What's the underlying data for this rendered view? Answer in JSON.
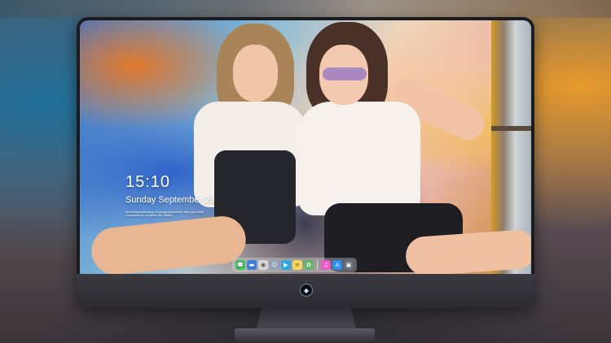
{
  "lockscreen": {
    "time": "15:10",
    "date": "Sunday September 28",
    "tagline": "Innovating technology, Ensuring productivity, Max, your ideal companion for a smarter life, Seewo"
  },
  "dock": {
    "icons": [
      {
        "name": "messages-icon",
        "glyph": "💬",
        "color": "#3cc45a"
      },
      {
        "name": "files-icon",
        "glyph": "▬",
        "color": "#3b7ddd"
      },
      {
        "name": "browser-icon",
        "glyph": "◉",
        "color": "#d8d8d8"
      },
      {
        "name": "finder-icon",
        "glyph": "☺",
        "color": "#8fa2b8"
      },
      {
        "name": "video-icon",
        "glyph": "▶",
        "color": "#29a9e0"
      },
      {
        "name": "notes-icon",
        "glyph": "≡",
        "color": "#f6d860"
      },
      {
        "name": "photos-icon",
        "glyph": "✿",
        "color": "#66b36b"
      },
      {
        "name": "music-icon",
        "glyph": "♫",
        "color": "#e95cc4"
      },
      {
        "name": "appstore-icon",
        "glyph": "A",
        "color": "#2f8ff0"
      },
      {
        "name": "settings-icon",
        "glyph": "▣",
        "color": "#6b6f78"
      }
    ]
  },
  "brand_logo_glyph": "◆"
}
